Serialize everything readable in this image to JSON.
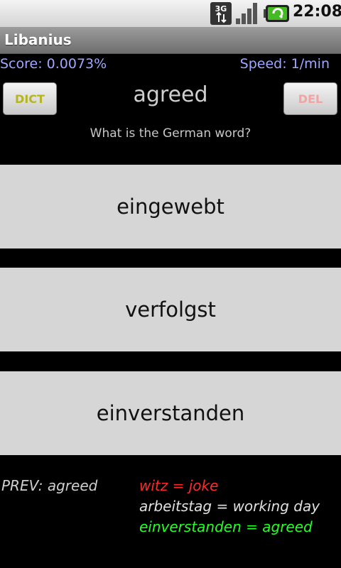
{
  "status_bar": {
    "network": "3G",
    "time": "22:08",
    "icons": [
      "3g-data-icon",
      "signal-strength-icon",
      "battery-charging-icon"
    ],
    "battery_color": "#44bb22"
  },
  "app": {
    "title": "Libanius"
  },
  "stats": {
    "score": "Score: 0.0073%",
    "speed": "Speed: 1/min",
    "color": "#9fa8ff"
  },
  "quiz": {
    "dict_label": "DICT",
    "del_label": "DEL",
    "prompt_word": "agreed",
    "question": "What is the German word?",
    "answers": [
      {
        "label": "eingewebt"
      },
      {
        "label": "verfolgst"
      },
      {
        "label": "einverstanden"
      }
    ]
  },
  "history": {
    "prev": "PREV: agreed",
    "entries": [
      {
        "text": "witz = joke",
        "color": "#ff2a2a"
      },
      {
        "text": "arbeitstag = working day",
        "color": "#e0e0e0"
      },
      {
        "text": "einverstanden = agreed",
        "color": "#22ff22"
      }
    ]
  }
}
